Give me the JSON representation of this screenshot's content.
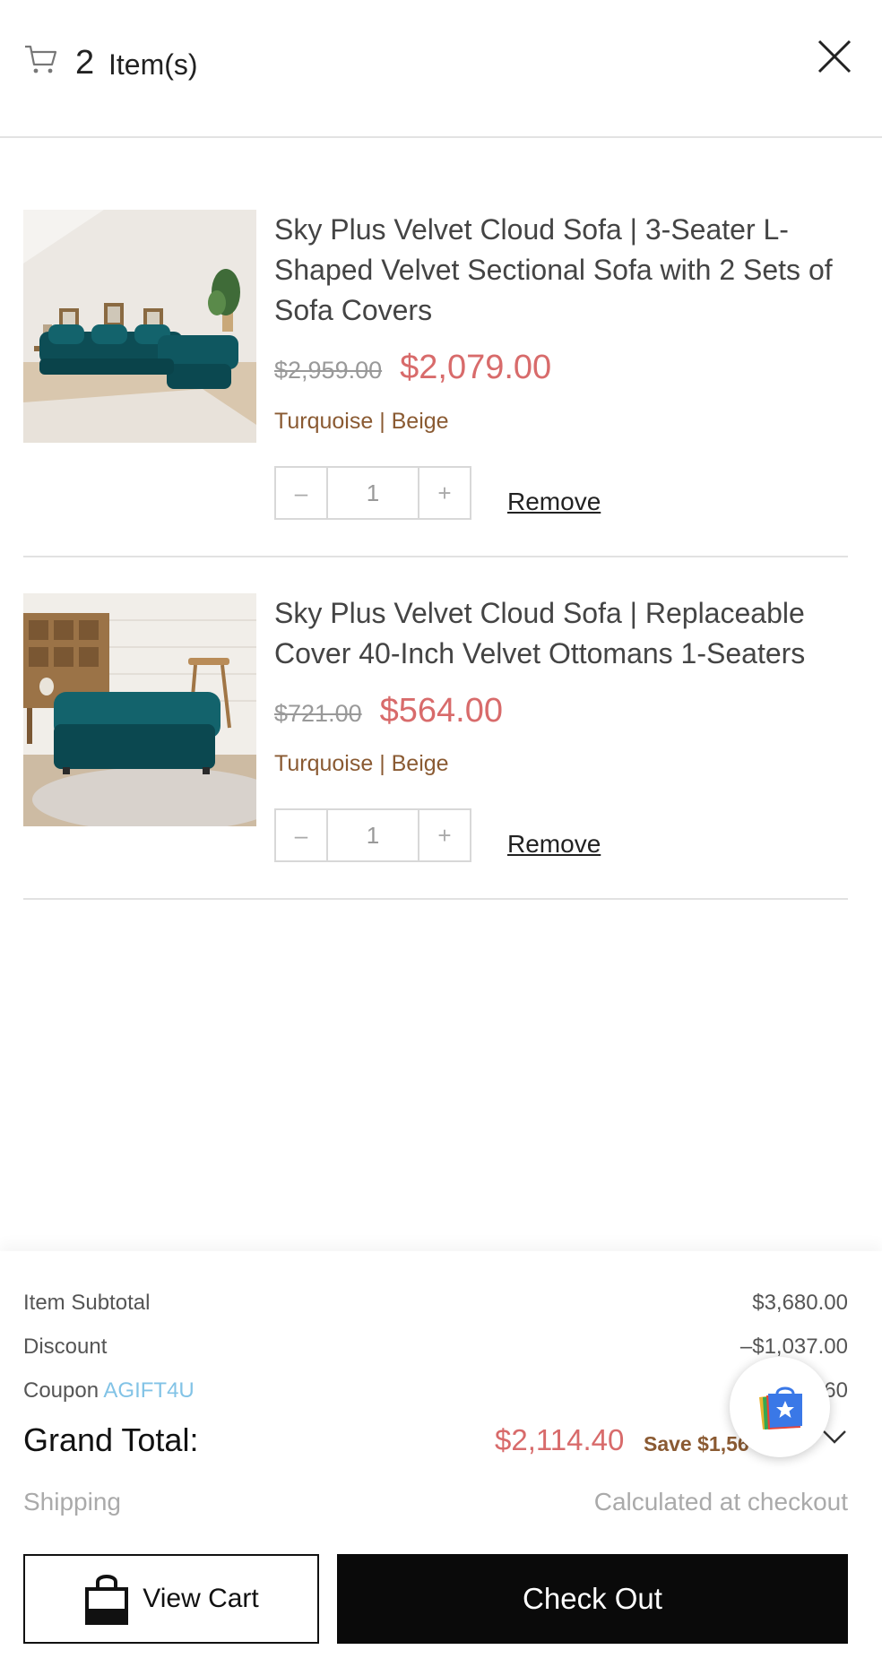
{
  "header": {
    "item_count": "2",
    "items_label": "Item(s)",
    "cart_icon": "cart-icon",
    "close_icon": "close-icon"
  },
  "items": [
    {
      "title": "Sky Plus Velvet Cloud Sofa | 3-Seater L-Shaped Velvet Sectional Sofa with 2 Sets of Sofa Covers",
      "original_price": "$2,959.00",
      "sale_price": "$2,079.00",
      "variant": "Turquoise | Beige",
      "quantity": "1",
      "minus_label": "–",
      "plus_label": "+",
      "remove_label": "Remove"
    },
    {
      "title": "Sky Plus Velvet Cloud Sofa | Replaceable Cover 40-Inch Velvet Ottomans 1-Seaters",
      "original_price": "$721.00",
      "sale_price": "$564.00",
      "variant": "Turquoise | Beige",
      "quantity": "1",
      "minus_label": "–",
      "plus_label": "+",
      "remove_label": "Remove"
    }
  ],
  "summary": {
    "subtotal_label": "Item Subtotal",
    "subtotal_value": "$3,680.00",
    "discount_label": "Discount",
    "discount_value": "–$1,037.00",
    "coupon_label": "Coupon",
    "coupon_code": "AGIFT4U",
    "coupon_value": "60",
    "grand_total_label": "Grand Total:",
    "grand_total_value": "$2,114.40",
    "save_text": "Save $1,56",
    "shipping_label": "Shipping",
    "shipping_value": "Calculated at checkout"
  },
  "buttons": {
    "view_cart": "View Cart",
    "check_out": "Check Out"
  },
  "colors": {
    "sale_price": "#d86b6b",
    "variant_text": "#8a5a32",
    "coupon_code": "#82c3e6",
    "checkout_bg": "#0a0a0a"
  }
}
